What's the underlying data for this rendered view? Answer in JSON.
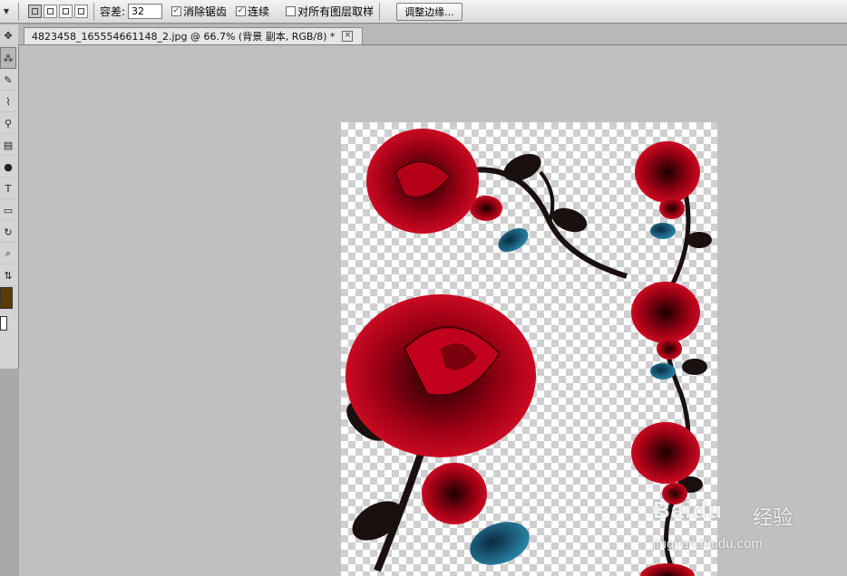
{
  "options_bar": {
    "tolerance_label": "容差:",
    "tolerance_value": "32",
    "antialias_label": "消除锯齿",
    "antialias_checked": true,
    "contiguous_label": "连续",
    "contiguous_checked": true,
    "sample_all_layers_label": "对所有图层取样",
    "sample_all_layers_checked": false,
    "refine_edge_button": "调整边缘..."
  },
  "document_tab": {
    "title": "4823458_165554661148_2.jpg @ 66.7% (背景 副本, RGB/8) *",
    "close": "×"
  },
  "toolbox": {
    "tools": [
      "move-icon",
      "magic-wand-icon",
      "eyedropper-icon",
      "brush-icon",
      "clone-stamp-icon",
      "gradient-icon",
      "dodge-icon",
      "type-icon",
      "shape-icon",
      "3d-rotate-icon",
      "zoom-icon",
      "swap-colors-icon"
    ],
    "type_glyph": "T",
    "foreground_color": "#5c3b00",
    "background_color": "#ffffff"
  },
  "watermark": {
    "logo": "Baidu",
    "suffix": "经验",
    "url": "jingyan.baidu.com"
  },
  "colors": {
    "rose_red": "#c4001a",
    "rose_dark": "#5a0008",
    "stem": "#1a1010",
    "leaf_blue": "#1b6d8c"
  }
}
